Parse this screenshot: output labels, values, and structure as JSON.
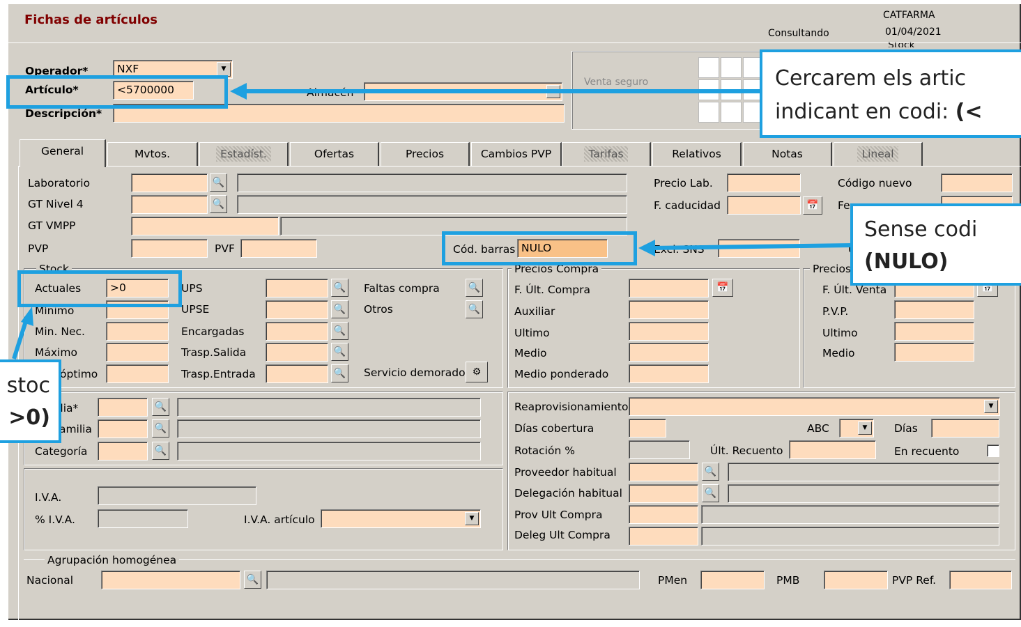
{
  "window": {
    "title": "Fichas de artículos",
    "mode": "Consultando",
    "company": "CATFARMA",
    "date": "01/04/2021",
    "stock_partial": "Stock"
  },
  "header": {
    "operador_label": "Operador*",
    "operador_value": "NXF",
    "articulo_label": "Artículo*",
    "articulo_value": "<5700000",
    "descripcion_label": "Descripción*",
    "almacen_label": "Almacén",
    "venta_seguro": "Venta seguro"
  },
  "tabs": [
    "General",
    "Mvtos.",
    "Estadíst.",
    "Ofertas",
    "Precios",
    "Cambios PVP",
    "Tarifas",
    "Relativos",
    "Notas",
    "Lineal"
  ],
  "general": {
    "laboratorio": "Laboratorio",
    "gt_nivel4": "GT Nivel 4",
    "gt_vmpp": "GT VMPP",
    "pvp": "PVP",
    "pvf": "PVF",
    "cod_barras_label": "Cód. barras",
    "cod_barras_value": "NULO",
    "precio_lab": "Precio Lab.",
    "f_caducidad": "F. caducidad",
    "codigo_nuevo": "Código nuevo",
    "fecha_cambio_partial": "Fe",
    "excl_sns": "Excl. SNS",
    "u_partial": "U"
  },
  "stock": {
    "title": "Stock",
    "actuales": "Actuales",
    "actuales_value": ">0",
    "minimo": "Mínimo",
    "min_nec": "Min. Nec.",
    "maximo": "Máximo",
    "optimo": "óptimo",
    "ups": "UPS",
    "upse": "UPSE",
    "encargadas": "Encargadas",
    "trasp_salida": "Trasp.Salida",
    "trasp_entrada": "Trasp.Entrada",
    "faltas_compra": "Faltas compra",
    "otros": "Otros",
    "servicio_demorado": "Servicio demorado"
  },
  "precios_compra": {
    "title": "Precios Compra",
    "f_ult_compra": "F. Últ. Compra",
    "auxiliar": "Auxiliar",
    "ultimo": "Ultimo",
    "medio": "Medio",
    "medio_ponderado": "Medio ponderado"
  },
  "precios_venta": {
    "title": "Precios",
    "f_ult_venta": "F. Últ. Venta",
    "pvp": "P.V.P.",
    "ultimo": "Ultimo",
    "medio": "Medio"
  },
  "familia": {
    "familia": "Familia*",
    "subfamilia": "Subfamilia",
    "categoria": "Categoría"
  },
  "iva": {
    "iva": "I.V.A.",
    "pct_iva": "% I.V.A.",
    "iva_articulo": "I.V.A. artículo"
  },
  "reaprov": {
    "reaprovisionamiento": "Reaprovisionamiento",
    "dias_cobertura": "Días cobertura",
    "abc": "ABC",
    "dias": "Días",
    "rotacion": "Rotación %",
    "ult_recuento": "Últ. Recuento",
    "en_recuento": "En recuento",
    "proveedor_habitual": "Proveedor habitual",
    "delegacion_habitual": "Delegación habitual",
    "prov_ult_compra": "Prov Ult Compra",
    "deleg_ult_compra": "Deleg Ult Compra"
  },
  "agrupacion": {
    "title": "Agrupación homogénea",
    "nacional": "Nacional",
    "pmen": "PMen",
    "pmb": "PMB",
    "pvp_ref": "PVP Ref."
  },
  "callouts": {
    "c1_line1": "Cercarem els artic",
    "c1_line2_pre": "indicant en codi: ",
    "c1_line2_bold": "(<",
    "c2_line1": "Sense codi",
    "c2_line2": "(NULO)",
    "c3_line1": "stoc",
    "c3_line2": ">0)"
  },
  "colors": {
    "field": "#fedcbd",
    "highlight": "#f9c187",
    "annotation": "#1ea0e0",
    "title": "#800000",
    "window": "#d4d0c8"
  },
  "icons": {
    "lookup": "lookup-icon",
    "calendar": "calendar-icon",
    "dropdown": "chevron-down-icon",
    "gear": "gear-icon"
  }
}
